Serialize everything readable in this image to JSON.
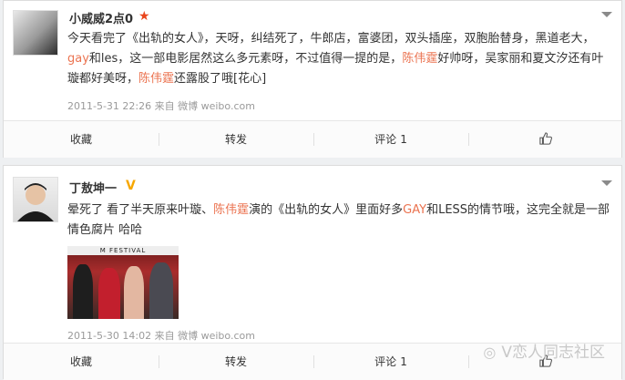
{
  "posts": [
    {
      "username": "小威威2点0",
      "badge": "★",
      "text_segments": [
        {
          "t": "今天看完了《出轨的女人》，天呀，纠结死了，牛郎店，富婆团，双头插座，双胞胎替身，黑道老大，",
          "hl": false
        },
        {
          "t": "gay",
          "hl": true
        },
        {
          "t": "和les，这一部电影居然这么多元素呀，不过值得一提的是，",
          "hl": false
        },
        {
          "t": "陈伟霆",
          "hl": true
        },
        {
          "t": "好帅呀，吴家丽和夏文汐还有叶璇都好美呀，",
          "hl": false
        },
        {
          "t": "陈伟霆",
          "hl": true
        },
        {
          "t": "还露股了哦[花心]",
          "hl": false
        }
      ],
      "meta": "2011-5-31 22:26 来自 微博 weibo.com",
      "actions": {
        "favorite": "收藏",
        "repost": "转发",
        "comment": "评论",
        "comment_count": "1"
      }
    },
    {
      "username": "丁敖坤一",
      "badge": "V",
      "text_segments": [
        {
          "t": "晕死了 看了半天原来叶璇、",
          "hl": false
        },
        {
          "t": "陈伟霆",
          "hl": true
        },
        {
          "t": "演的《出轨的女人》里面好多",
          "hl": false
        },
        {
          "t": "GAY",
          "hl": true
        },
        {
          "t": "和LESS的情节哦，这完全就是一部情色腐片 哈哈",
          "hl": false
        }
      ],
      "image_banner": "M FESTIVAL",
      "meta": "2011-5-30 14:02 来自 微博 weibo.com",
      "actions": {
        "favorite": "收藏",
        "repost": "转发",
        "comment": "评论",
        "comment_count": "1"
      }
    }
  ],
  "watermark": "V恋人同志社区",
  "colors": {
    "highlight": "#eb7350",
    "star": "#e9451c",
    "verified": "#f7a700"
  }
}
